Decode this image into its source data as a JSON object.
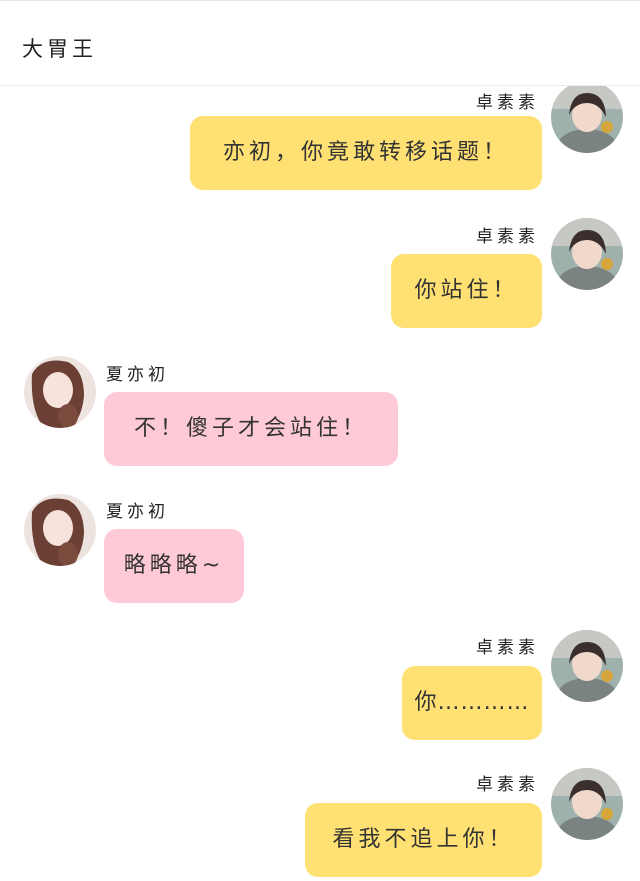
{
  "header": {
    "title": "大胃王"
  },
  "messages": [
    {
      "side": "right",
      "sender": "卓素素",
      "text": "亦初，你竟敢转移话题！",
      "avatar_icon": "avatar-zhuo-susu"
    },
    {
      "side": "right",
      "sender": "卓素素",
      "text": "你站住！",
      "avatar_icon": "avatar-zhuo-susu"
    },
    {
      "side": "left",
      "sender": "夏亦初",
      "text": "不！傻子才会站住！",
      "avatar_icon": "avatar-xia-yichu"
    },
    {
      "side": "left",
      "sender": "夏亦初",
      "text": "略略略~",
      "avatar_icon": "avatar-xia-yichu"
    },
    {
      "side": "right",
      "sender": "卓素素",
      "text": "你…………",
      "avatar_icon": "avatar-zhuo-susu"
    },
    {
      "side": "right",
      "sender": "卓素素",
      "text": "看我不追上你！",
      "avatar_icon": "avatar-zhuo-susu"
    }
  ],
  "colors": {
    "right_bubble": "#ffe073",
    "left_bubble": "#ffcad7"
  }
}
